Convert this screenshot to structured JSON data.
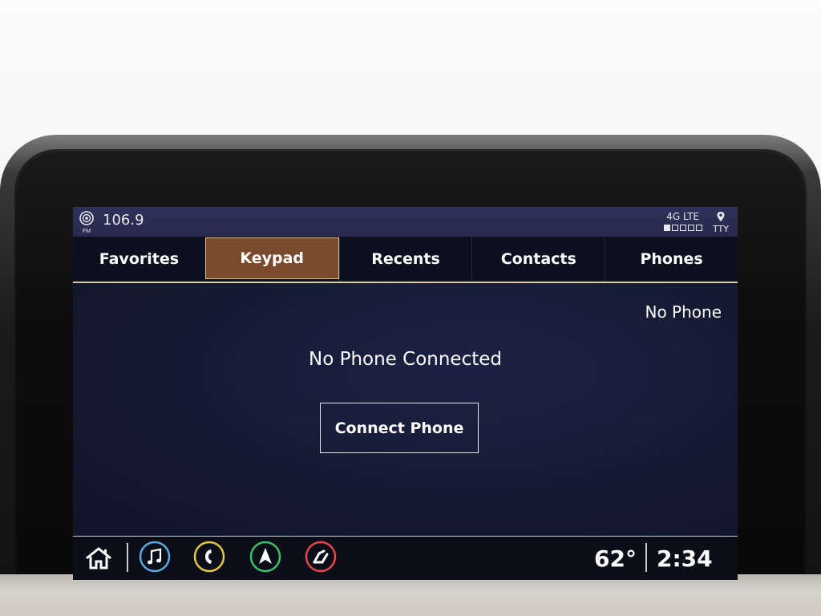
{
  "status_bar": {
    "radio_band": "FM",
    "radio_frequency": "106.9",
    "network_type": "4G LTE",
    "signal_bars_filled": 1,
    "signal_bars_total": 5,
    "tty_label": "TTY",
    "icons": [
      "radio-station-icon",
      "location-pin-icon"
    ]
  },
  "tabs": [
    {
      "label": "Favorites",
      "active": false
    },
    {
      "label": "Keypad",
      "active": true
    },
    {
      "label": "Recents",
      "active": false
    },
    {
      "label": "Contacts",
      "active": false
    },
    {
      "label": "Phones",
      "active": false
    }
  ],
  "main": {
    "phone_status": "No Phone",
    "headline": "No Phone Connected",
    "connect_button_label": "Connect Phone"
  },
  "bottom_bar": {
    "apps": [
      {
        "name": "home-icon",
        "color": "#ffffff"
      },
      {
        "name": "music-icon",
        "color": "#5aa8e0"
      },
      {
        "name": "phone-icon",
        "color": "#e8c640"
      },
      {
        "name": "navigation-icon",
        "color": "#3fbf6a"
      },
      {
        "name": "seat-settings-icon",
        "color": "#e04a4a"
      }
    ],
    "temperature": "62°",
    "time": "2:34"
  },
  "colors": {
    "active_tab": "#7a4a2f",
    "tab_underline": "#d8c9a3",
    "status_bar": "#2e3259",
    "screen_bg": "#14182a"
  }
}
